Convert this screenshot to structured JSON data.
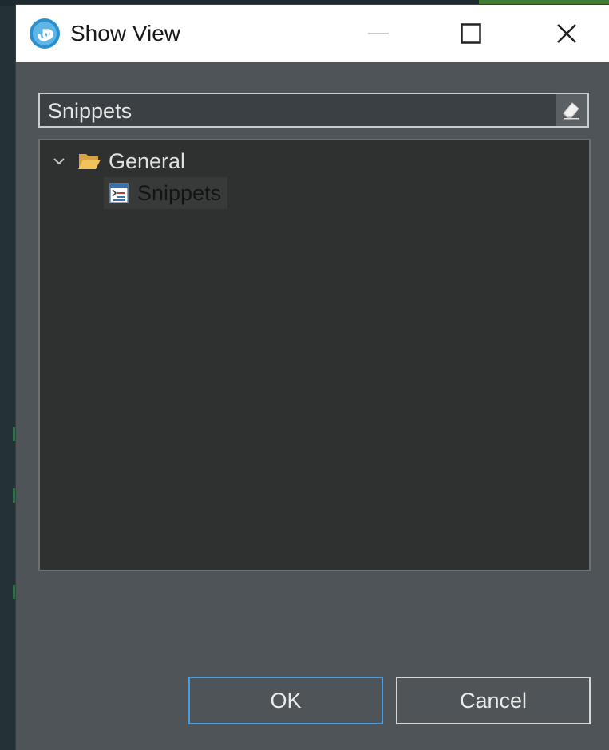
{
  "window": {
    "title": "Show View",
    "controls": {
      "minimize": "minimize-icon",
      "maximize": "maximize-icon",
      "close": "close-icon"
    }
  },
  "filter": {
    "value": "Snippets",
    "clear_icon": "eraser-icon"
  },
  "tree": {
    "items": [
      {
        "label": "General",
        "icon": "folder-open-icon",
        "expanded": true,
        "children": [
          {
            "label": "Snippets",
            "icon": "snippets-view-icon",
            "selected": true
          }
        ]
      }
    ]
  },
  "buttons": {
    "ok_label": "OK",
    "cancel_label": "Cancel"
  },
  "colors": {
    "dialog_bg": "#4e5458",
    "tree_bg": "#2f3030",
    "titlebar_bg": "#ffffff",
    "default_button_border": "#4a9ee0",
    "folder": "#e8b64a"
  }
}
